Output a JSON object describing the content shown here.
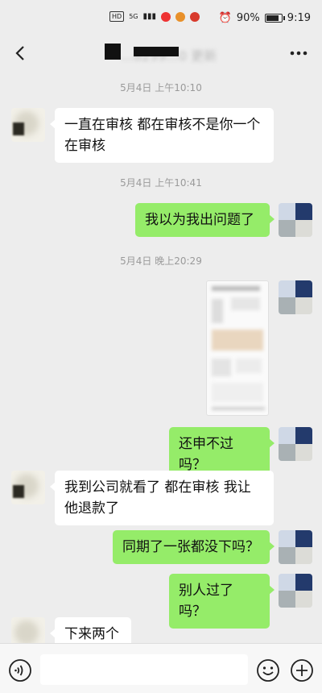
{
  "status_bar": {
    "left_chip": "HD",
    "signal": "5G",
    "battery": "90%",
    "battery_level": 0.9,
    "time": "9:19"
  },
  "nav": {
    "title": "...8299...0 更新"
  },
  "messages": [
    {
      "type": "timestamp",
      "text": "5月4日 上午10:10"
    },
    {
      "type": "text",
      "side": "left",
      "text": "一直在审核 都在审核不是你一个在审核"
    },
    {
      "type": "timestamp",
      "text": "5月4日 上午10:41"
    },
    {
      "type": "text",
      "side": "right",
      "text": "我以为我出问题了"
    },
    {
      "type": "timestamp",
      "text": "5月4日 晚上20:29"
    },
    {
      "type": "image",
      "side": "right"
    },
    {
      "type": "text",
      "side": "right",
      "text": "还申不过吗？"
    },
    {
      "type": "text",
      "side": "left",
      "text": "我到公司就看了 都在审核 我让他退款了"
    },
    {
      "type": "text",
      "side": "right",
      "text": "同期了一张都没下吗？"
    },
    {
      "type": "text",
      "side": "right",
      "text": "别人过了吗？"
    },
    {
      "type": "text",
      "side": "left",
      "text": "下来两个"
    }
  ],
  "colors": {
    "background": "#ededed",
    "incoming_bubble": "#ffffff",
    "outgoing_bubble": "#95ec69",
    "timestamp": "#9a9a9a"
  },
  "icons": {
    "back": "chevron-left-icon",
    "more": "more-dots-icon",
    "voice": "voice-icon",
    "emoji": "emoji-icon",
    "plus": "plus-icon"
  }
}
